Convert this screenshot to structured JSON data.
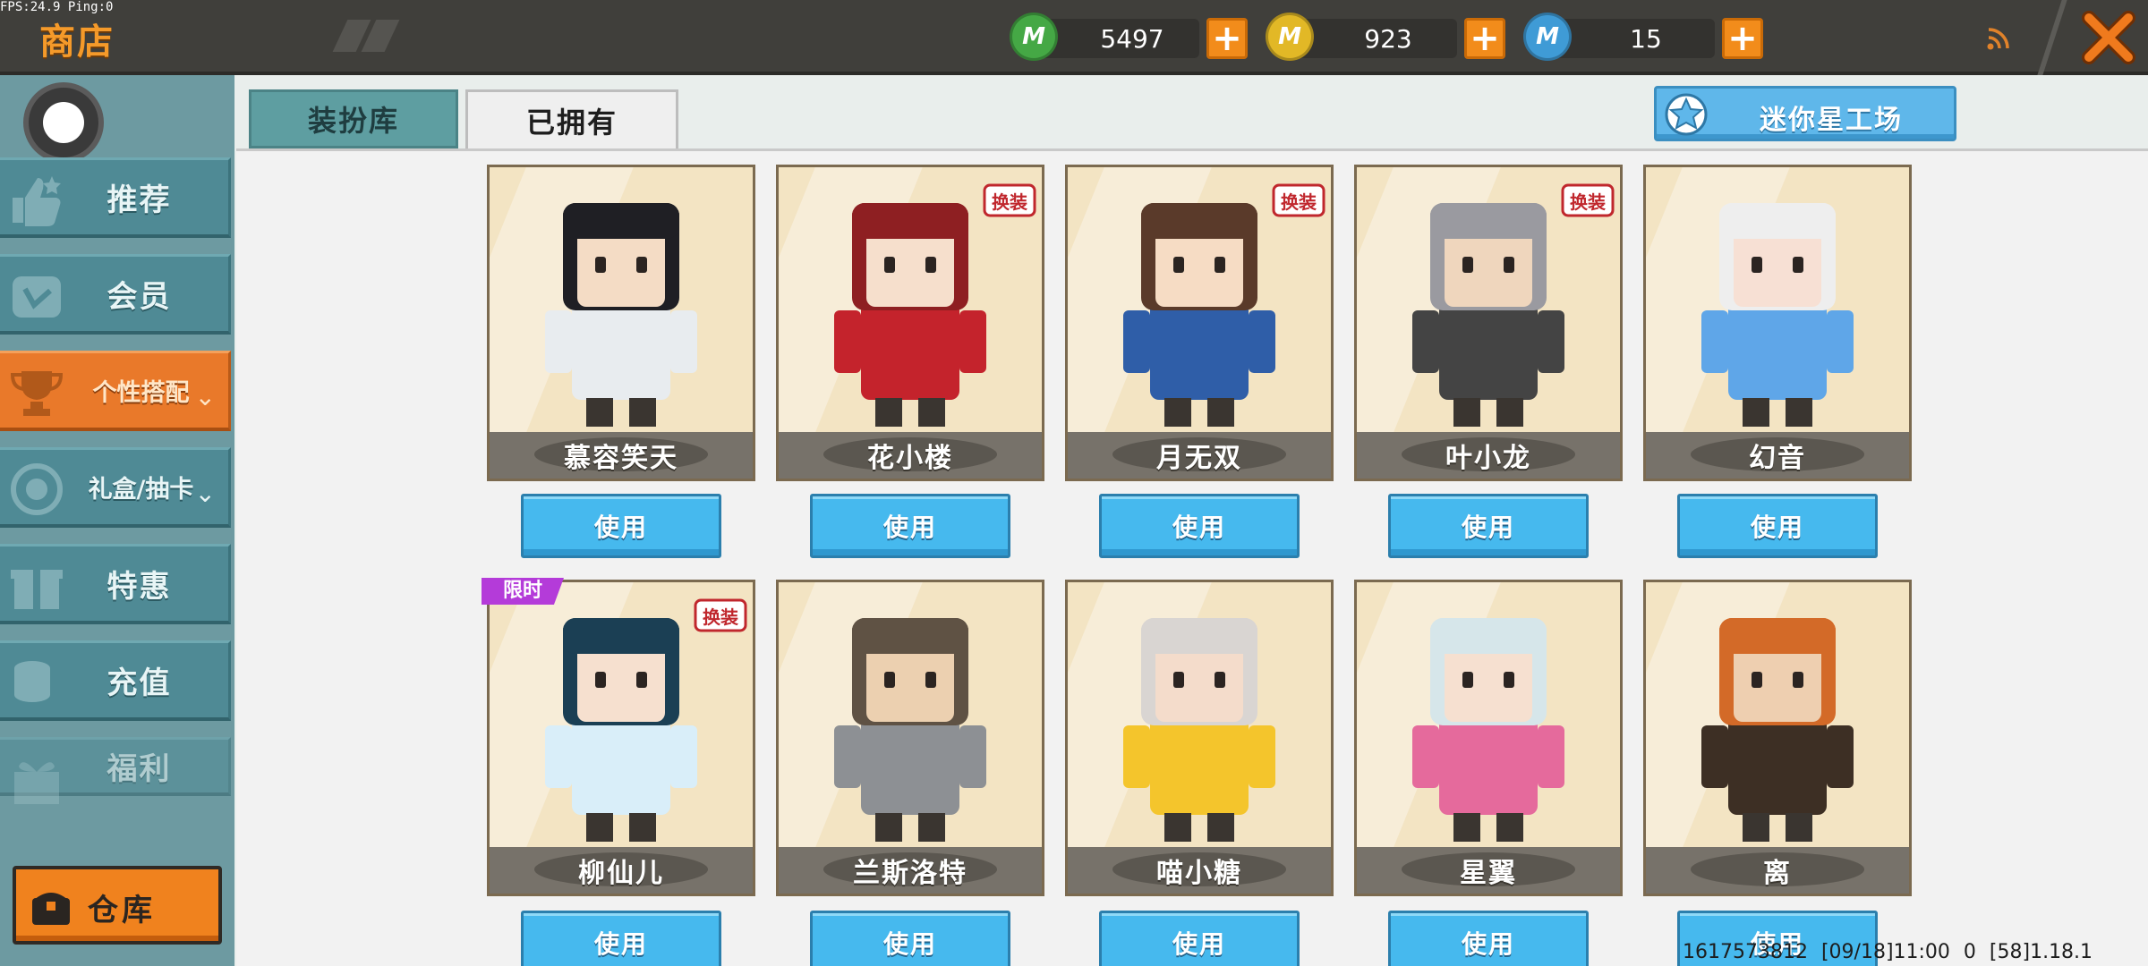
{
  "debug": {
    "fps": "FPS:24.9  Ping:0"
  },
  "header": {
    "title": "商店",
    "currencies": [
      {
        "icon": "green-gem-icon",
        "letter": "M",
        "value": "5497",
        "color": "#45a845"
      },
      {
        "icon": "gold-coin-icon",
        "letter": "M",
        "value": "923",
        "color": "#e2b826"
      },
      {
        "icon": "blue-star-coin-icon",
        "letter": "M",
        "value": "15",
        "color": "#3f9bd6"
      }
    ]
  },
  "sidebar": {
    "items": [
      {
        "label": "推荐",
        "icon": "thumbs-up-icon"
      },
      {
        "label": "会员",
        "icon": "vip-badge-icon"
      },
      {
        "label": "个性搭配",
        "icon": "trophy-icon",
        "active": true
      },
      {
        "label": "礼盒/抽卡",
        "icon": "lottery-icon"
      },
      {
        "label": "特惠",
        "icon": "gift-icon"
      },
      {
        "label": "充值",
        "icon": "coins-stack-icon"
      },
      {
        "label": "福利",
        "icon": "present-icon"
      }
    ],
    "warehouse_label": "仓库"
  },
  "tabs": [
    {
      "label": "装扮库",
      "active": false
    },
    {
      "label": "已拥有",
      "active": true
    }
  ],
  "workshop_label": "迷你星工场",
  "limited_label": "限时",
  "skins": [
    {
      "name": "慕容笑天",
      "button": "使用",
      "badge": false,
      "hair": "#1f1f24",
      "skin": "#f4dcc5",
      "outfit": "#e8ecef"
    },
    {
      "name": "花小楼",
      "button": "使用",
      "badge": true,
      "hair": "#8e1f22",
      "skin": "#f6dfcc",
      "outfit": "#c4232c"
    },
    {
      "name": "月无双",
      "button": "使用",
      "badge": true,
      "hair": "#5a3a2a",
      "skin": "#f6dcc4",
      "outfit": "#2f5ea8"
    },
    {
      "name": "叶小龙",
      "button": "使用",
      "badge": true,
      "hair": "#9a9aa0",
      "skin": "#efd6bd",
      "outfit": "#444444"
    },
    {
      "name": "幻音",
      "button": "使用",
      "badge": false,
      "hair": "#eeeeee",
      "skin": "#f7e0d4",
      "outfit": "#5fa6e8"
    },
    {
      "name": "柳仙儿",
      "button": "使用",
      "badge": true,
      "hair": "#1b3f54",
      "skin": "#f6e0cf",
      "outfit": "#d9eef9"
    },
    {
      "name": "兰斯洛特",
      "button": "使用",
      "badge": false,
      "hair": "#5f5244",
      "skin": "#ecd0b0",
      "outfit": "#8d9094"
    },
    {
      "name": "喵小糖",
      "button": "使用",
      "badge": false,
      "hair": "#d9d5d2",
      "skin": "#f4dccb",
      "outfit": "#f4c52c"
    },
    {
      "name": "星翼",
      "button": "使用",
      "badge": false,
      "hair": "#d6e6ea",
      "skin": "#f6e0d0",
      "outfit": "#e56a9c"
    },
    {
      "name": "离",
      "button": "使用",
      "badge": false,
      "hair": "#d36a28",
      "skin": "#eecfb0",
      "outfit": "#3d2f24"
    }
  ],
  "badge_text": "换装",
  "footer": {
    "info": "1617573812   [09/18]11:00 0   [58]1.18.1"
  }
}
